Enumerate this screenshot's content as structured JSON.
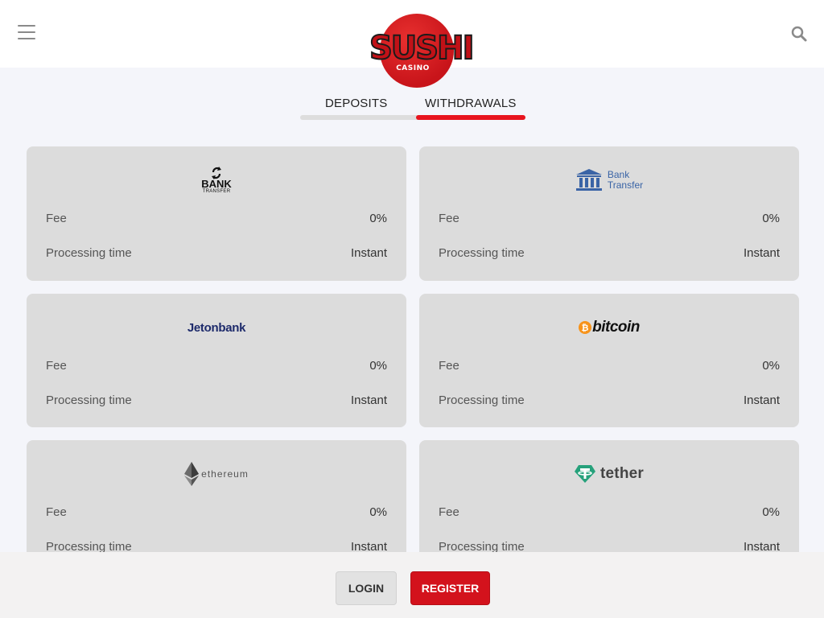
{
  "header": {
    "logo": {
      "brand": "SUSHI",
      "sub": "CASINO",
      "circle_color": "#d11a1f"
    }
  },
  "tabs": [
    {
      "label": "DEPOSITS",
      "active": false
    },
    {
      "label": "WITHDRAWALS",
      "active": true
    }
  ],
  "accent_color": "#e8141e",
  "methods": [
    {
      "name": "bank-transfer-1",
      "logo_text": "BANK",
      "logo_subtext": "TRANSFER",
      "fee_label": "Fee",
      "fee": "0%",
      "time_label": "Processing time",
      "time": "Instant"
    },
    {
      "name": "bank-transfer-2",
      "logo_line1": "Bank",
      "logo_line2": "Transfer",
      "fee_label": "Fee",
      "fee": "0%",
      "time_label": "Processing time",
      "time": "Instant"
    },
    {
      "name": "jetonbank",
      "logo_text": "Jetonbank",
      "fee_label": "Fee",
      "fee": "0%",
      "time_label": "Processing time",
      "time": "Instant"
    },
    {
      "name": "bitcoin",
      "logo_text": "bitcoin",
      "fee_label": "Fee",
      "fee": "0%",
      "time_label": "Processing time",
      "time": "Instant"
    },
    {
      "name": "ethereum",
      "logo_text": "ethereum",
      "fee_label": "Fee",
      "fee": "0%",
      "time_label": "Processing time",
      "time": "Instant"
    },
    {
      "name": "tether",
      "logo_text": "tether",
      "fee_label": "Fee",
      "fee": "0%",
      "time_label": "Processing time",
      "time": "Instant"
    }
  ],
  "footer": {
    "login_label": "LOGIN",
    "register_label": "REGISTER",
    "register_color": "#d3121c"
  }
}
